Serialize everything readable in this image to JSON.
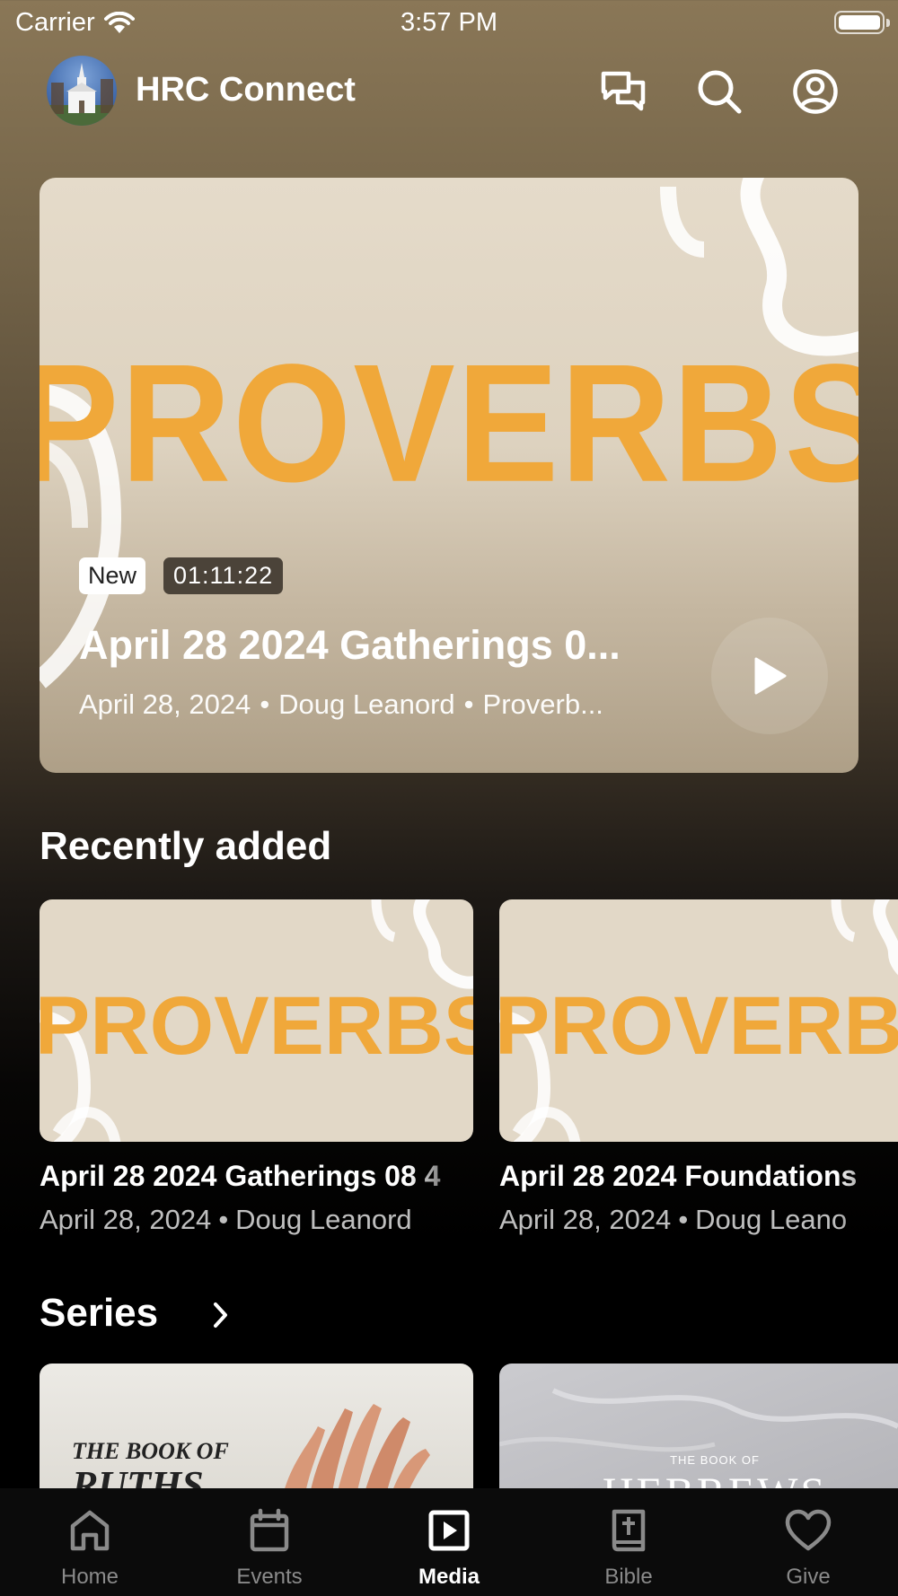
{
  "status_bar": {
    "carrier": "Carrier",
    "time": "3:57 PM"
  },
  "header": {
    "title": "HRC Connect",
    "icons": [
      "chat-icon",
      "search-icon",
      "profile-icon"
    ]
  },
  "hero": {
    "art_text": "PROVERBS",
    "badge_new": "New",
    "duration": "01:11:22",
    "title": "April 28 2024 Gatherings 0...",
    "date": "April 28, 2024",
    "speaker": "Doug Leanord",
    "series": "Proverb..."
  },
  "recently_added": {
    "title": "Recently added",
    "items": [
      {
        "art_text": "PROVERBS",
        "title": "April 28 2024 Gatherings 08 4",
        "date": "April 28, 2024",
        "speaker": "Doug Leanord"
      },
      {
        "art_text": "PROVERBS",
        "title": "April 28 2024 Foundations",
        "date": "April 28, 2024",
        "speaker": "Doug Leano"
      }
    ]
  },
  "series": {
    "title": "Series",
    "items": [
      {
        "art_top": "THE BOOK OF",
        "art_main": "RUTHS"
      },
      {
        "art_top": "THE BOOK OF",
        "art_main": "HEBREWS"
      }
    ]
  },
  "tabs": [
    {
      "label": "Home",
      "icon": "home-icon",
      "active": false
    },
    {
      "label": "Events",
      "icon": "calendar-icon",
      "active": false
    },
    {
      "label": "Media",
      "icon": "media-icon",
      "active": true
    },
    {
      "label": "Bible",
      "icon": "bible-icon",
      "active": false
    },
    {
      "label": "Give",
      "icon": "heart-icon",
      "active": false
    }
  ],
  "colors": {
    "accent_orange": "#f0a83a",
    "card_beige": "#e2d8c7"
  }
}
